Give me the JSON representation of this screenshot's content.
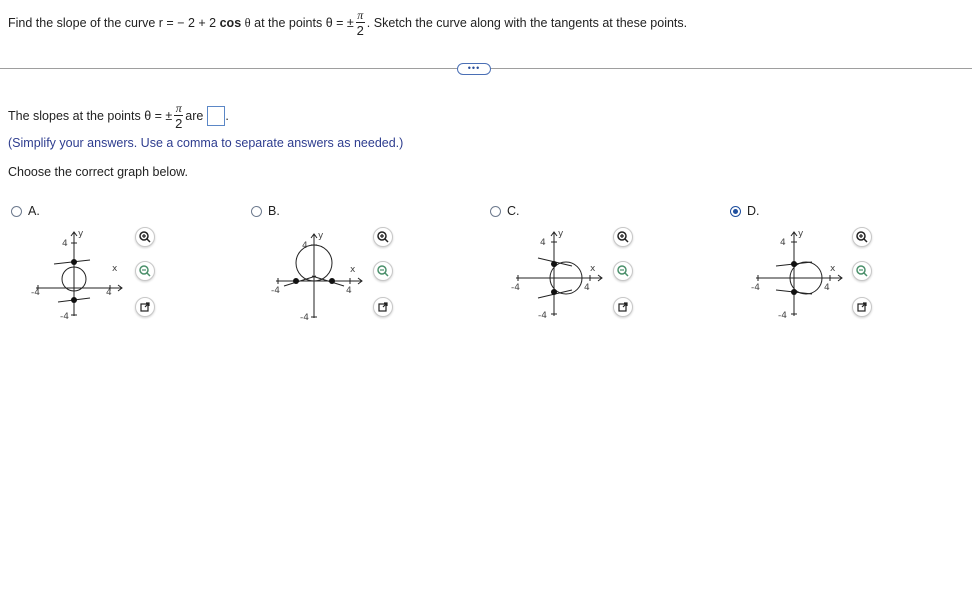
{
  "question": {
    "prefix": "Find the slope of the curve r = − 2 + 2",
    "cos": "cos",
    "theta": "θ",
    "mid": "at the points",
    "eq": "θ = ±",
    "frac_num": "π",
    "frac_den": "2",
    "suffix": ". Sketch the curve along with the tangents at these points."
  },
  "more_label": "•••",
  "answer": {
    "prefix": "The slopes at the points",
    "eq": "θ = ±",
    "frac_num": "π",
    "frac_den": "2",
    "are": "are",
    "period": ".",
    "hint": "(Simplify your answers. Use a comma to separate answers as needed.)",
    "choose": "Choose the correct graph below."
  },
  "options": [
    {
      "label": "A.",
      "selected": false
    },
    {
      "label": "B.",
      "selected": false
    },
    {
      "label": "C.",
      "selected": false
    },
    {
      "label": "D.",
      "selected": true
    }
  ],
  "axis": {
    "x": "x",
    "y": "y",
    "pos": "4",
    "neg": "-4"
  },
  "icons": {
    "zoom_in": "zoom-in-icon",
    "zoom_out": "zoom-out-icon",
    "open": "open-new-window-icon"
  },
  "colors": {
    "accent": "#1f4f9e",
    "hint": "#2e3d8f",
    "separator": "#9e9e9e"
  }
}
